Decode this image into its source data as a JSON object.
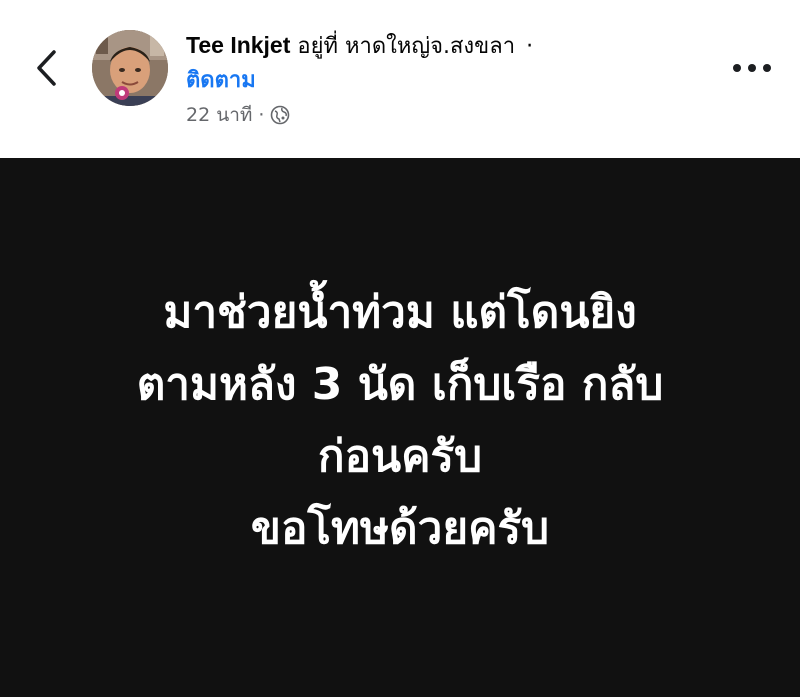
{
  "header": {
    "back_icon": "chevron-left-icon",
    "author_name": "Tee Inkjet",
    "location_text": "อยู่ที่ หาดใหญ่จ.สงขลา",
    "separator": "·",
    "follow_label": "ติดตาม",
    "timestamp": "22 นาที",
    "timestamp_separator": "·",
    "privacy_icon": "globe-icon",
    "more_icon": "more-horizontal-icon"
  },
  "post": {
    "background_color": "#111111",
    "lines": [
      "มาช่วยน้ำท่วม แต่โดนยิง",
      "ตามหลัง 3 นัด  เก็บเรือ กลับ",
      "ก่อนครับ",
      "ขอโทษด้วยครับ"
    ]
  },
  "colors": {
    "link_blue": "#1877f2",
    "secondary_text": "#65676b",
    "primary_text": "#050505"
  }
}
